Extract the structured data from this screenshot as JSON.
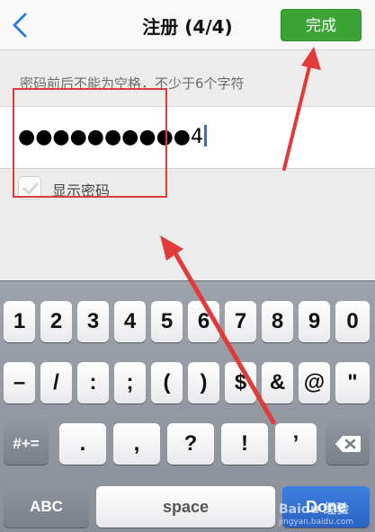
{
  "navbar": {
    "back_icon": "chevron-left-icon",
    "title": "注册 (4/4)",
    "done_label": "完成",
    "done_color": "#3aa435"
  },
  "form": {
    "hint": "密码前后不能为空格，不少于6个字符",
    "password_value": "●●●●●●●●●●4",
    "show_password_label": "显示密码",
    "show_password_checked": false
  },
  "keyboard": {
    "row1": [
      "1",
      "2",
      "3",
      "4",
      "5",
      "6",
      "7",
      "8",
      "9",
      "0"
    ],
    "row2": [
      "–",
      "/",
      ":",
      ";",
      "(",
      ")",
      "$",
      "&",
      "@",
      "\""
    ],
    "row3": [
      ".",
      ",",
      "?",
      "!",
      "’"
    ],
    "symbols_label": "#+=",
    "backspace_icon": "backspace-icon",
    "abc_label": "ABC",
    "space_label": "space",
    "done_label": "Done"
  },
  "watermark": {
    "line1": "Baidu 经验",
    "line2": "jingyan.baidu.com"
  },
  "annotation_color": "#e23a3a"
}
